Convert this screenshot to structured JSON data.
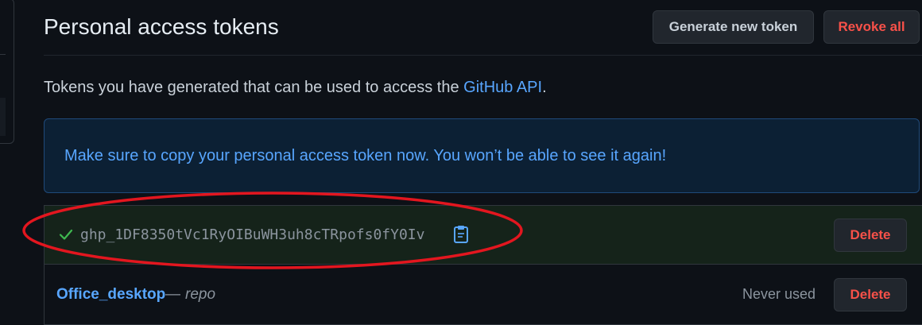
{
  "header": {
    "title": "Personal access tokens",
    "generate_label": "Generate new token",
    "revoke_all_label": "Revoke all"
  },
  "intro": {
    "text": "Tokens you have generated that can be used to access the ",
    "link": "GitHub API",
    "suffix": "."
  },
  "flash": {
    "message": "Make sure to copy your personal access token now. You won’t be able to see it again!"
  },
  "new_token": {
    "value": "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",
    "delete_label": "Delete"
  },
  "tokens": [
    {
      "name": "Office_desktop",
      "separator": "—",
      "scope": "repo",
      "last_used": "Never used",
      "delete_label": "Delete"
    }
  ],
  "colors": {
    "background": "#0d1117",
    "link": "#58a6ff",
    "danger": "#f85149",
    "success": "#3fb950",
    "annotation": "#e3161f"
  }
}
